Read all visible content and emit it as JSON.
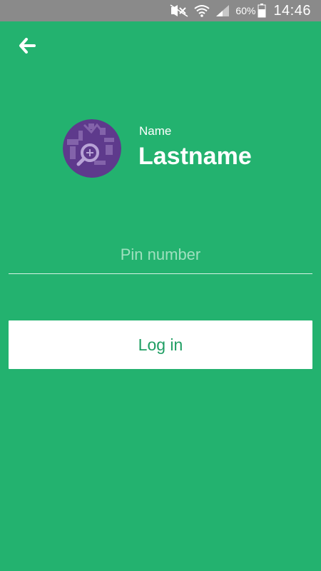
{
  "status_bar": {
    "battery_percent": "60%",
    "time": "14:46",
    "icons": [
      "mute-icon",
      "wifi-icon",
      "signal-icon",
      "battery-icon"
    ]
  },
  "header": {
    "back_icon": "arrow-left-icon"
  },
  "profile": {
    "first_name": "Name",
    "last_name": "Lastname",
    "avatar_color": "#5e3a8c"
  },
  "form": {
    "pin_placeholder": "Pin number",
    "pin_value": ""
  },
  "actions": {
    "login_label": "Log in"
  },
  "colors": {
    "background": "#23b26f",
    "status_bar": "#8a8a8a",
    "button_text": "#1f9e63"
  }
}
